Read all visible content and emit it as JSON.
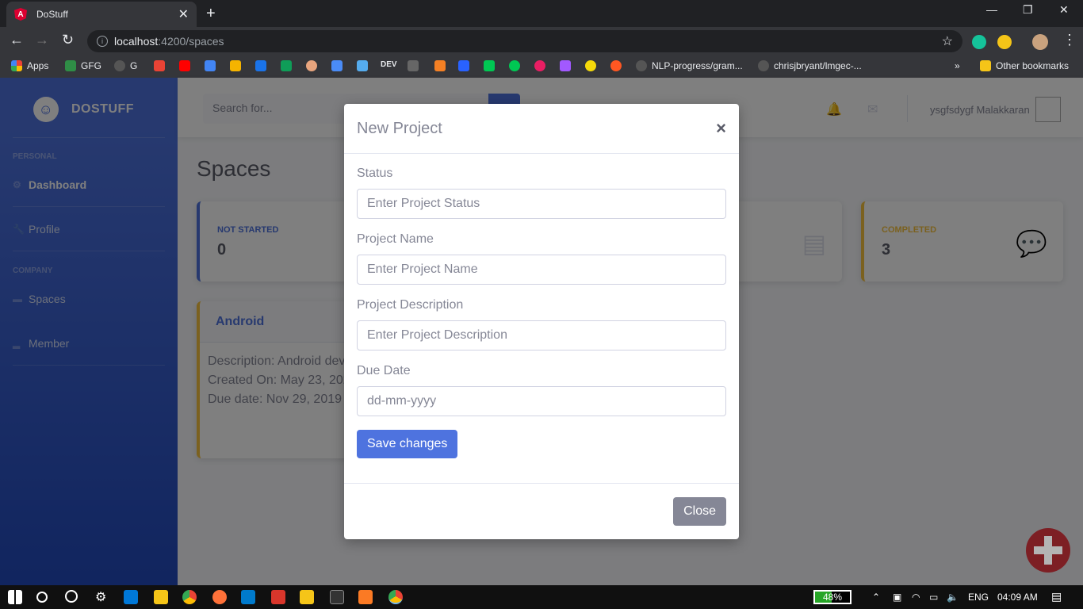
{
  "browser": {
    "tab_title": "DoStuff",
    "url_host": "localhost",
    "url_path": ":4200/spaces",
    "bookmarks": [
      "Apps",
      "GFG",
      "G",
      "DEV",
      "NLP-progress/gram...",
      "chrisjbryant/lmgec-..."
    ],
    "other_bookmarks": "Other bookmarks"
  },
  "sidebar": {
    "brand": "DOSTUFF",
    "heading_personal": "PERSONAL",
    "heading_company": "COMPANY",
    "items": [
      {
        "label": "Dashboard",
        "icon": "gear-icon"
      },
      {
        "label": "Profile",
        "icon": "wrench-icon"
      },
      {
        "label": "Spaces",
        "icon": "folder-icon"
      },
      {
        "label": "Member",
        "icon": "chart-icon"
      }
    ]
  },
  "topbar": {
    "search_placeholder": "Search for...",
    "username": "ysgfsdygf Malakkaran"
  },
  "main": {
    "title": "Spaces",
    "stats": [
      {
        "label": "NOT STARTED",
        "value": "0",
        "color": "#4e73df"
      },
      {
        "label": "",
        "value": "",
        "color": "#1cc88a"
      },
      {
        "label": "COMPLETED",
        "value": "3",
        "color": "#f6c23e"
      }
    ],
    "project": {
      "name": "Android",
      "description": "Description: Android development",
      "created": "Created On: May 23, 202",
      "due": "Due date: Nov 29, 2019"
    }
  },
  "modal": {
    "title": "New Project",
    "close_symbol": "×",
    "fields": [
      {
        "label": "Status",
        "placeholder": "Enter Project Status"
      },
      {
        "label": "Project Name",
        "placeholder": "Enter Project Name"
      },
      {
        "label": "Project Description",
        "placeholder": "Enter Project Description"
      },
      {
        "label": "Due Date",
        "placeholder": "dd-mm-yyyy"
      }
    ],
    "save_label": "Save changes",
    "close_label": "Close"
  },
  "taskbar": {
    "battery": "48%",
    "language": "ENG",
    "time": "04:09 AM"
  }
}
